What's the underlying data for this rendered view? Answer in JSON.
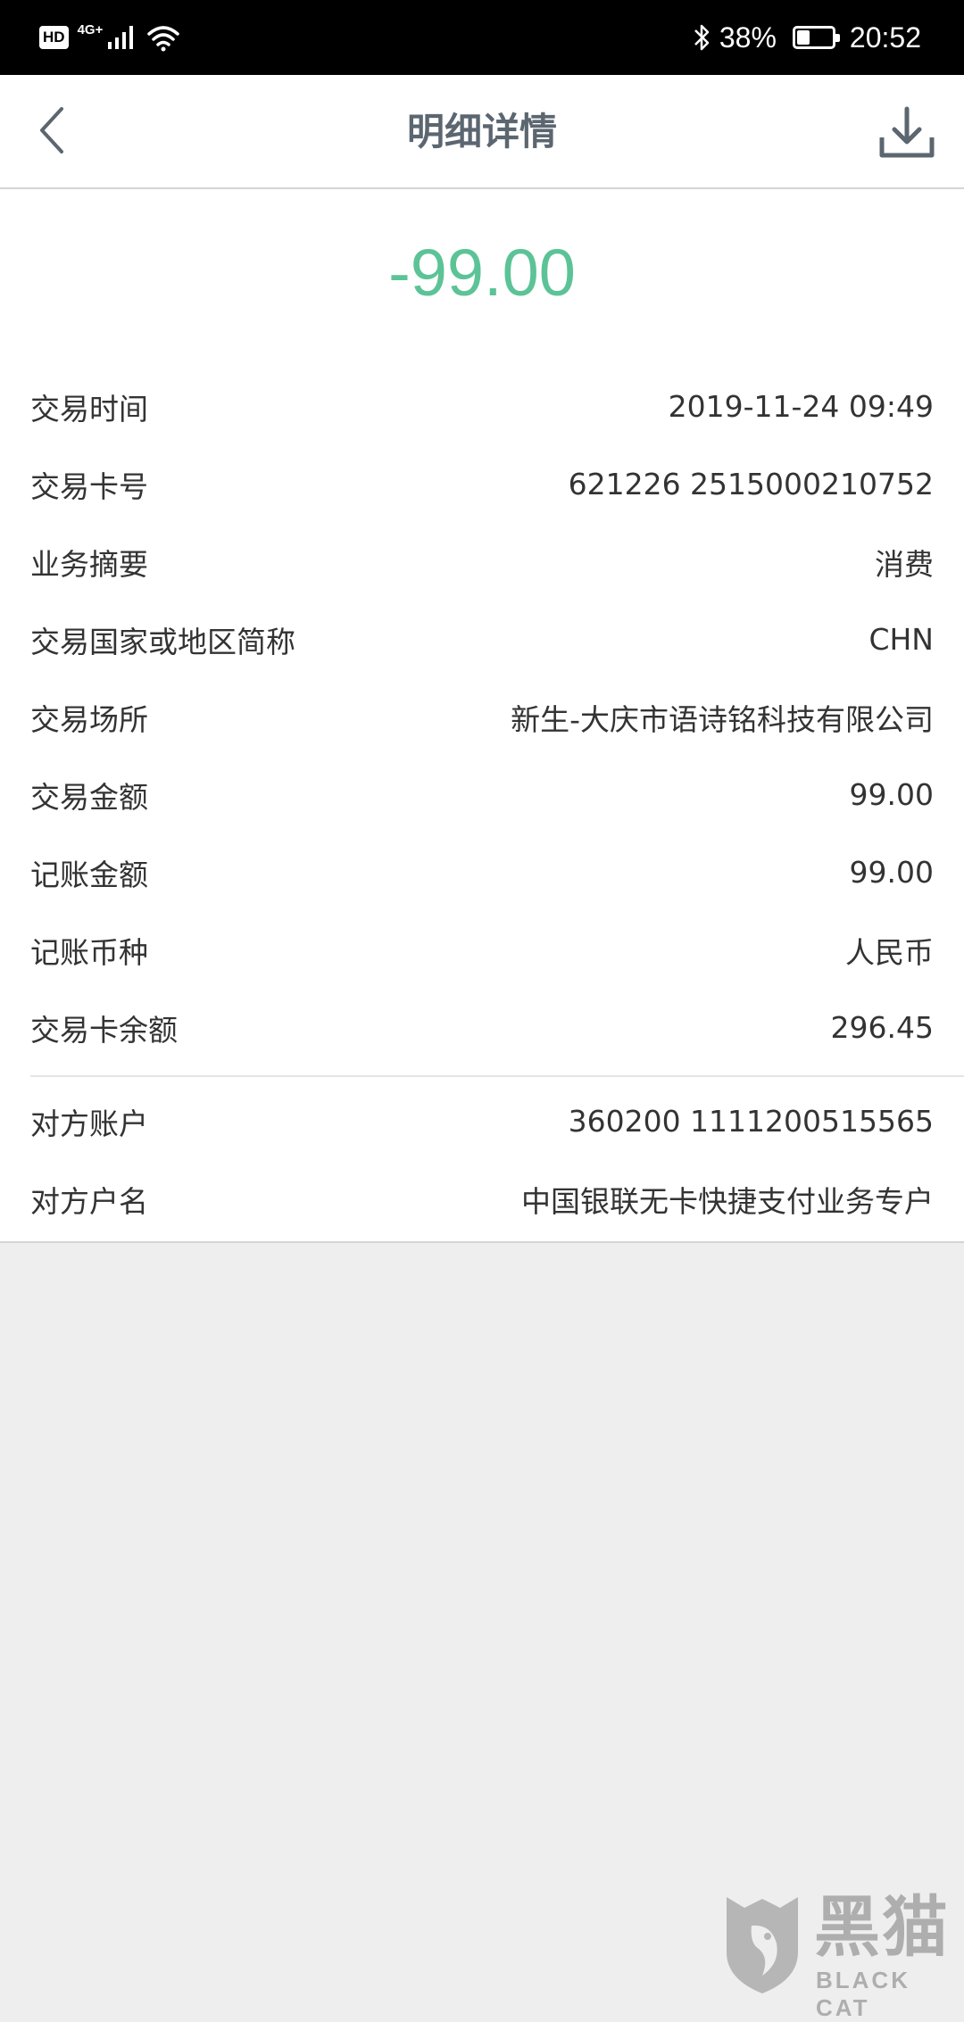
{
  "status_bar": {
    "hd_label": "HD",
    "network_label": "4G+",
    "battery_percent": "38%",
    "battery_level": 0.38,
    "time": "20:52",
    "icons": [
      "signal-icon",
      "wifi-icon",
      "bluetooth-icon",
      "battery-icon"
    ]
  },
  "header": {
    "title": "明细详情",
    "back_icon": "chevron-left-icon",
    "download_icon": "download-icon"
  },
  "amount": "-99.00",
  "colors": {
    "amount": "#5cc397",
    "title": "#5b6670",
    "background": "#eeeeee"
  },
  "details": [
    {
      "label": "交易时间",
      "value": "2019-11-24 09:49"
    },
    {
      "label": "交易卡号",
      "value": "621226 2515000210752"
    },
    {
      "label": "业务摘要",
      "value": "消费"
    },
    {
      "label": "交易国家或地区简称",
      "value": "CHN"
    },
    {
      "label": "交易场所",
      "value": "新生-大庆市语诗铭科技有限公司"
    },
    {
      "label": "交易金额",
      "value": "99.00"
    },
    {
      "label": "记账金额",
      "value": "99.00"
    },
    {
      "label": "记账币种",
      "value": "人民币"
    },
    {
      "label": "交易卡余额",
      "value": "296.45"
    }
  ],
  "counterparty": [
    {
      "label": "对方账户",
      "value": "360200 1111200515565"
    },
    {
      "label": "对方户名",
      "value": "中国银联无卡快捷支付业务专户"
    }
  ],
  "watermark": {
    "cn": "黑猫",
    "en": "BLACK CAT"
  }
}
